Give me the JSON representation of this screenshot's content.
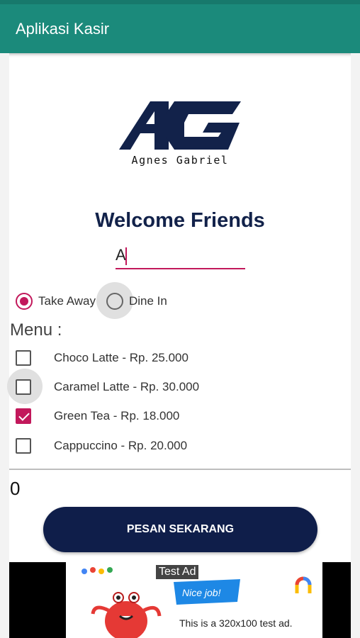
{
  "app": {
    "title": "Aplikasi Kasir"
  },
  "logo": {
    "initials": "AG",
    "caption": "Agnes Gabriel"
  },
  "welcome": "Welcome Friends",
  "name_input": {
    "value": "A"
  },
  "order_type": {
    "options": [
      {
        "label": "Take Away",
        "checked": true
      },
      {
        "label": "Dine In",
        "checked": false
      }
    ]
  },
  "menu": {
    "label": "Menu :",
    "items": [
      {
        "label": "Choco Latte - Rp. 25.000",
        "checked": false
      },
      {
        "label": "Caramel Latte - Rp. 30.000",
        "checked": false
      },
      {
        "label": "Green Tea - Rp. 18.000",
        "checked": true
      },
      {
        "label": "Cappuccino - Rp. 20.000",
        "checked": false
      }
    ]
  },
  "total": "0",
  "order_button": "PESAN SEKARANG",
  "ad": {
    "tag": "Test Ad",
    "flag_text": "Nice job!",
    "text": "This is a 320x100 test ad."
  },
  "colors": {
    "appbar": "#1b8a7b",
    "accent": "#c2185b",
    "button": "#0f1e4a",
    "title": "#12224a"
  }
}
